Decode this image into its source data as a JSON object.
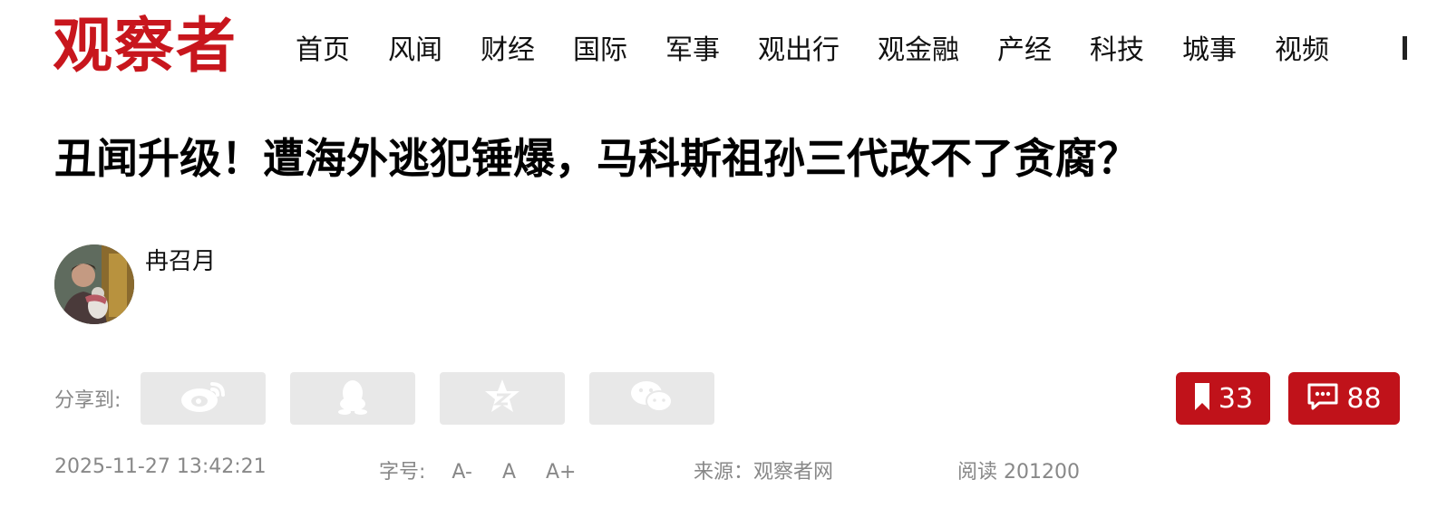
{
  "header": {
    "logo_text": "观察者",
    "nav": [
      "首页",
      "风闻",
      "财经",
      "国际",
      "军事",
      "观出行",
      "观金融",
      "产经",
      "科技",
      "城事",
      "视频"
    ]
  },
  "article": {
    "title": "丑闻升级！遭海外逃犯锤爆，马科斯祖孙三代改不了贪腐？",
    "author": "冉召月",
    "share_label": "分享到:",
    "share_targets": [
      {
        "icon": "weibo-icon"
      },
      {
        "icon": "qq-icon"
      },
      {
        "icon": "qzone-icon"
      },
      {
        "icon": "wechat-icon"
      }
    ],
    "bookmark_count": "33",
    "comment_count": "88",
    "datetime": "2025-11-27 13:42:21",
    "font_size_label": "字号:",
    "font_sizes": [
      "A-",
      "A",
      "A+"
    ],
    "source": "来源：观察者网",
    "reads": "阅读 201200"
  },
  "colors": {
    "brand": "#c8161d",
    "stat_button": "#c0121a",
    "share_button_bg": "#e8e8e8",
    "meta_text": "#888888"
  }
}
